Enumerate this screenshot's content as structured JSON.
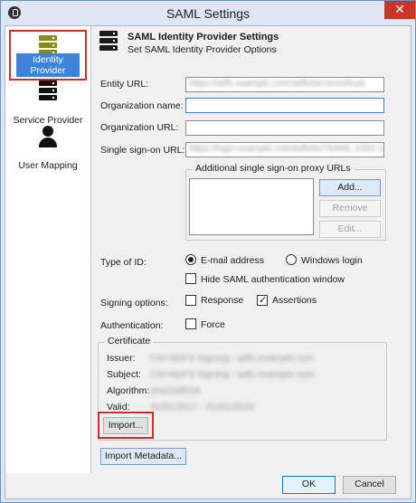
{
  "window": {
    "title": "SAML Settings",
    "close_glyph": "✕"
  },
  "sidebar": {
    "items": [
      {
        "label": "Identity Provider",
        "icon": "server-icon",
        "icon_color": "#8a8a1c"
      },
      {
        "label": "Service Provider",
        "icon": "server-icon",
        "icon_color": "#111111"
      },
      {
        "label": "User Mapping",
        "icon": "user-icon",
        "icon_color": "#111111"
      }
    ]
  },
  "header": {
    "title": "SAML Identity Provider Settings",
    "subtitle": "Set SAML Identity Provider Options"
  },
  "fields": {
    "entity_url": {
      "label": "Entity URL:",
      "value": "https://adfs.example.com/adfs/services/trust"
    },
    "org_name": {
      "label": "Organization name:",
      "value": ""
    },
    "org_url": {
      "label": "Organization URL:",
      "value": ""
    },
    "sso_url": {
      "label": "Single sign-on URL:",
      "value": "https://login.example.com/adfs/ls/?SAML 1333 1222"
    }
  },
  "proxy": {
    "group_title": "Additional single sign-on proxy URLs",
    "add": "Add...",
    "remove": "Remove",
    "edit": "Edit..."
  },
  "type_of_id": {
    "label": "Type of ID:",
    "email": "E-mail address",
    "windows": "Windows login",
    "selected": "email",
    "hide_saml": "Hide SAML authentication window"
  },
  "signing": {
    "label": "Signing options:",
    "response": "Response",
    "assertions": "Assertions",
    "response_checked": false,
    "assertions_checked": true
  },
  "authentication": {
    "label": "Authentication:",
    "force": "Force",
    "force_checked": false
  },
  "certificate": {
    "group_title": "Certificate",
    "issuer_label": "Issuer:",
    "issuer_value": "CN=ADFS Signing - adfs.example.com",
    "subject_label": "Subject:",
    "subject_value": "CN=ADFS Signing - adfs.example.com",
    "algorithm_label": "Algorithm:",
    "algorithm_value": "sha256RSA",
    "valid_label": "Valid:",
    "valid_value": "01/01/2017 - 01/01/2018",
    "import": "Import..."
  },
  "import_metadata": "Import Metadata...",
  "footer": {
    "ok": "OK",
    "cancel": "Cancel"
  }
}
